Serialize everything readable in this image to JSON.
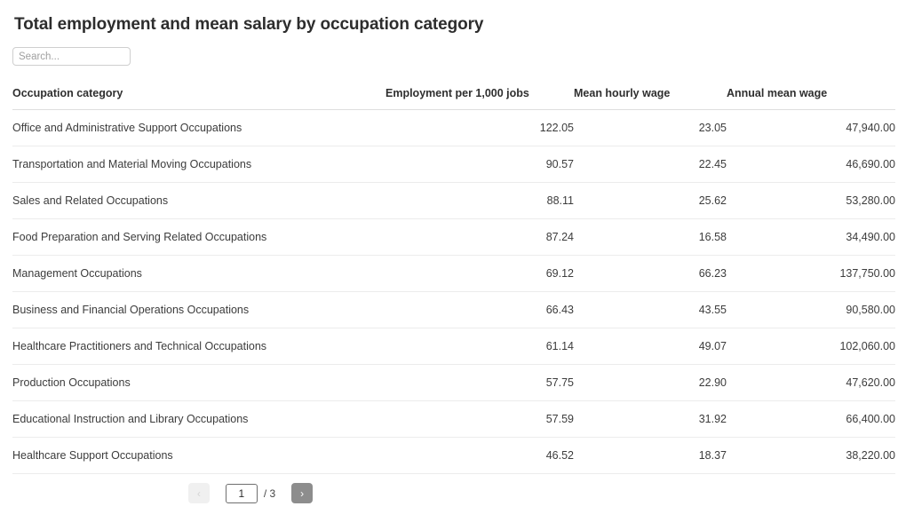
{
  "page_title": "Total employment and mean salary by occupation category",
  "search": {
    "placeholder": "Search...",
    "value": ""
  },
  "table": {
    "columns": [
      "Occupation category",
      "Employment per 1,000 jobs",
      "Mean hourly wage",
      "Annual mean wage"
    ],
    "rows": [
      {
        "occupation": "Office and Administrative Support Occupations",
        "employment_per_1000": "122.05",
        "mean_hourly_wage": "23.05",
        "annual_mean_wage": "47,940.00"
      },
      {
        "occupation": "Transportation and Material Moving Occupations",
        "employment_per_1000": "90.57",
        "mean_hourly_wage": "22.45",
        "annual_mean_wage": "46,690.00"
      },
      {
        "occupation": "Sales and Related Occupations",
        "employment_per_1000": "88.11",
        "mean_hourly_wage": "25.62",
        "annual_mean_wage": "53,280.00"
      },
      {
        "occupation": "Food Preparation and Serving Related Occupations",
        "employment_per_1000": "87.24",
        "mean_hourly_wage": "16.58",
        "annual_mean_wage": "34,490.00"
      },
      {
        "occupation": "Management Occupations",
        "employment_per_1000": "69.12",
        "mean_hourly_wage": "66.23",
        "annual_mean_wage": "137,750.00"
      },
      {
        "occupation": "Business and Financial Operations Occupations",
        "employment_per_1000": "66.43",
        "mean_hourly_wage": "43.55",
        "annual_mean_wage": "90,580.00"
      },
      {
        "occupation": "Healthcare Practitioners and Technical Occupations",
        "employment_per_1000": "61.14",
        "mean_hourly_wage": "49.07",
        "annual_mean_wage": "102,060.00"
      },
      {
        "occupation": "Production Occupations",
        "employment_per_1000": "57.75",
        "mean_hourly_wage": "22.90",
        "annual_mean_wage": "47,620.00"
      },
      {
        "occupation": "Educational Instruction and Library Occupations",
        "employment_per_1000": "57.59",
        "mean_hourly_wage": "31.92",
        "annual_mean_wage": "66,400.00"
      },
      {
        "occupation": "Healthcare Support Occupations",
        "employment_per_1000": "46.52",
        "mean_hourly_wage": "18.37",
        "annual_mean_wage": "38,220.00"
      }
    ]
  },
  "pagination": {
    "prev_label": "‹",
    "next_label": "›",
    "current_page": "1",
    "total_pages_label": "/ 3",
    "prev_enabled": false,
    "next_enabled": true
  },
  "colors": {
    "title": "#2d2d2d",
    "header_text": "#2f2f2f",
    "cell_text": "#3c3c3c",
    "row_border": "#ececec",
    "header_border": "#dedede",
    "pager_next_bg": "#8d8d8d",
    "pager_prev_bg": "#f0f0f0"
  }
}
